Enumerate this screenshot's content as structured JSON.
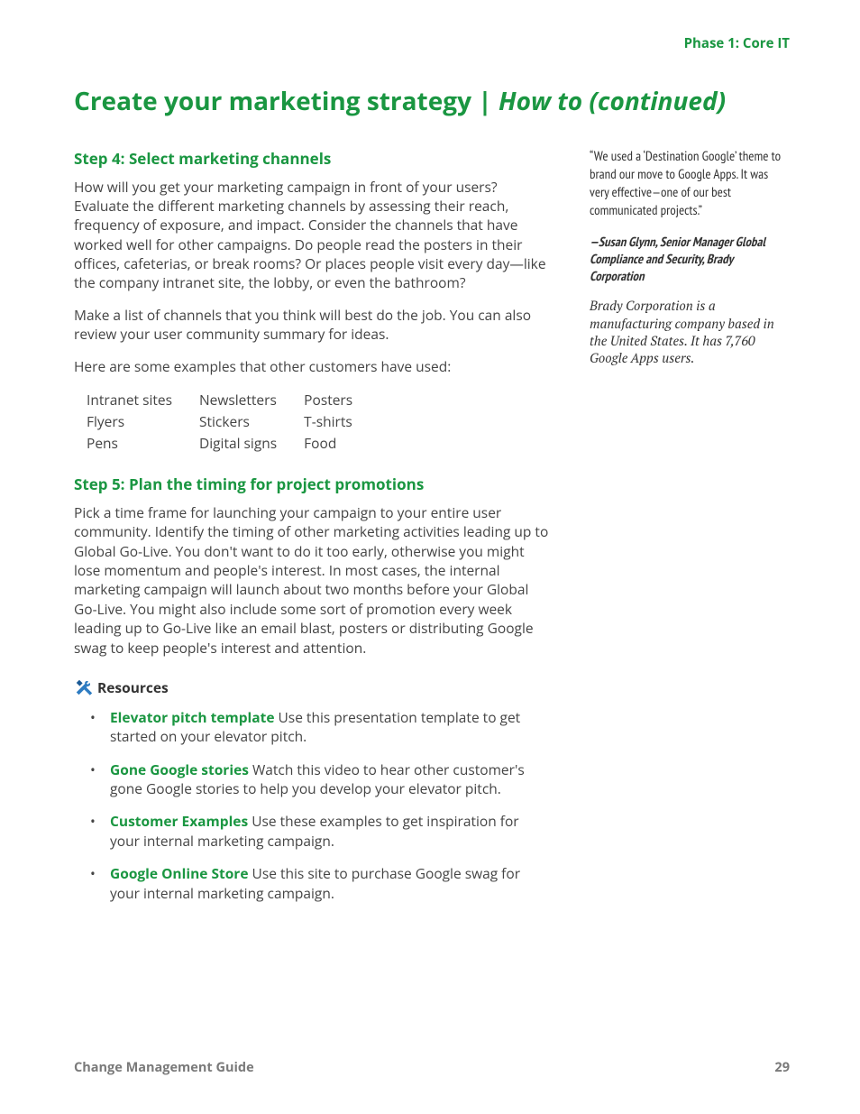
{
  "header": {
    "phase": "Phase 1: Core IT"
  },
  "title": {
    "main": "Create your marketing strategy | ",
    "sub": "How to (continued)"
  },
  "step4": {
    "heading": "Step 4: Select marketing channels",
    "p1": "How will you get your marketing campaign in front of your users? Evaluate the different marketing channels by assessing their reach, frequency of exposure, and impact. Consider the channels that have worked well for other campaigns. Do people read the posters in their offices, cafeterias, or break rooms? Or places people visit every day—like the company intranet site, the lobby, or even the bathroom?",
    "p2": "Make a list of channels that you think will best do the job. You can also review your user community summary for ideas.",
    "p3": "Here are some examples that other customers have used:",
    "table": [
      [
        "Intranet sites",
        "Newsletters",
        "Posters"
      ],
      [
        "Flyers",
        "Stickers",
        "T-shirts"
      ],
      [
        "Pens",
        "Digital signs",
        "Food"
      ]
    ]
  },
  "step5": {
    "heading": "Step 5: Plan the timing for project promotions",
    "p1": "Pick a time frame for launching your campaign to your entire user community. Identify the timing of other marketing activities leading up to Global Go-Live. You don't want to do it too early, otherwise you might lose momentum and people's interest. In most cases, the internal marketing campaign will launch about two months before your Global Go-Live. You might also include some sort of promotion every week leading up to Go-Live like an email blast, posters or distributing Google swag to keep people's interest and attention."
  },
  "resources": {
    "heading": "Resources",
    "items": [
      {
        "link": "Elevator pitch template",
        "text": "  Use this presentation template to get started on your elevator pitch."
      },
      {
        "link": "Gone Google stories",
        "text": "  Watch this video to hear other customer's gone Google stories to help you develop your elevator pitch."
      },
      {
        "link": "Customer Examples",
        "text": "  Use these examples to get inspiration for your internal marketing campaign."
      },
      {
        "link": "Google Online Store",
        "text": "  Use this site to purchase Google swag for your internal marketing campaign."
      }
    ]
  },
  "sidebar": {
    "quote": "“We used a ‘Destination Google’ theme to brand our move to Google Apps. It was very effective—one of our best communicated projects.”",
    "attribution": "—Susan Glynn, Senior Manager Global Compliance and Security, Brady Corporation",
    "note": "Brady Corporation is a manufacturing company based in the United States. It has 7,760 Google Apps users."
  },
  "footer": {
    "doc": "Change Management Guide",
    "page": "29"
  }
}
